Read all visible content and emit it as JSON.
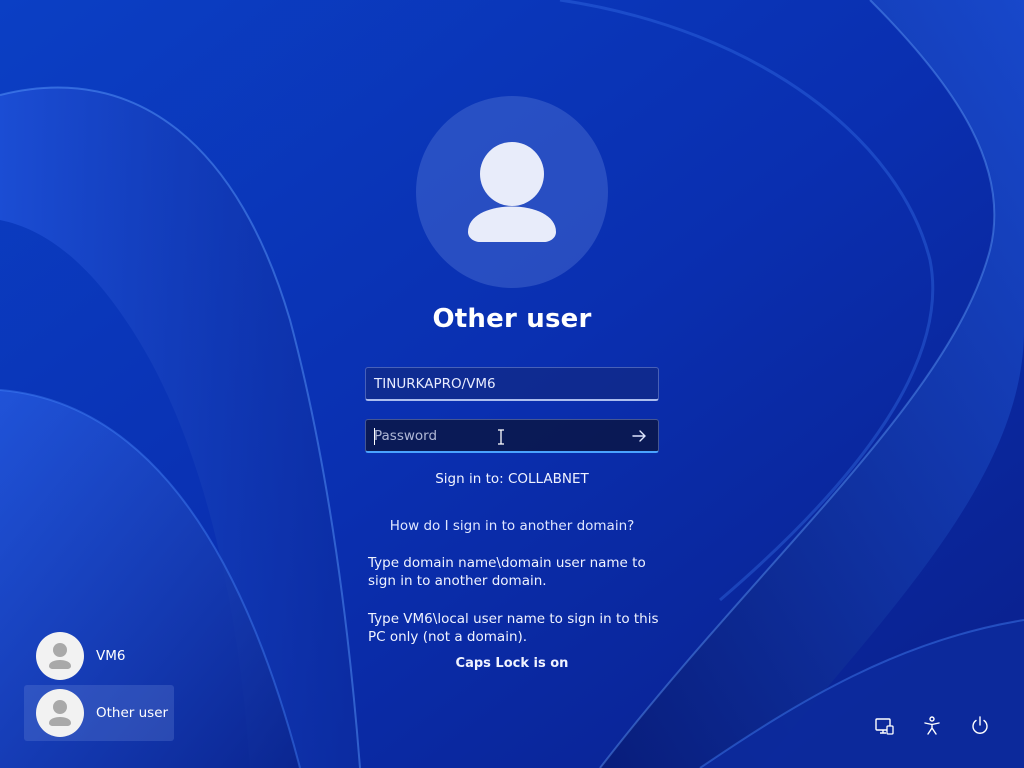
{
  "login": {
    "title": "Other user",
    "username_value": "TINURKAPRO/VM6",
    "password_placeholder": "Password",
    "sign_in_to": "Sign in to: COLLABNET",
    "help_link": "How do I sign in to another domain?",
    "help_text_1": "Type domain name\\domain user name to sign in to another domain.",
    "help_text_2": "Type VM6\\local user name to sign in to this PC only (not a domain).",
    "caps_lock_warning": "Caps Lock is on",
    "submit_icon": "arrow-right-icon"
  },
  "users": [
    {
      "name": "VM6",
      "icon": "user-icon",
      "selected": false
    },
    {
      "name": "Other user",
      "icon": "user-icon",
      "selected": true
    }
  ],
  "system_icons": [
    "network-icon",
    "accessibility-icon",
    "power-icon"
  ],
  "colors": {
    "background": "#0a2fb0",
    "focus_underline": "#4aa3ff",
    "text": "#ffffff"
  }
}
